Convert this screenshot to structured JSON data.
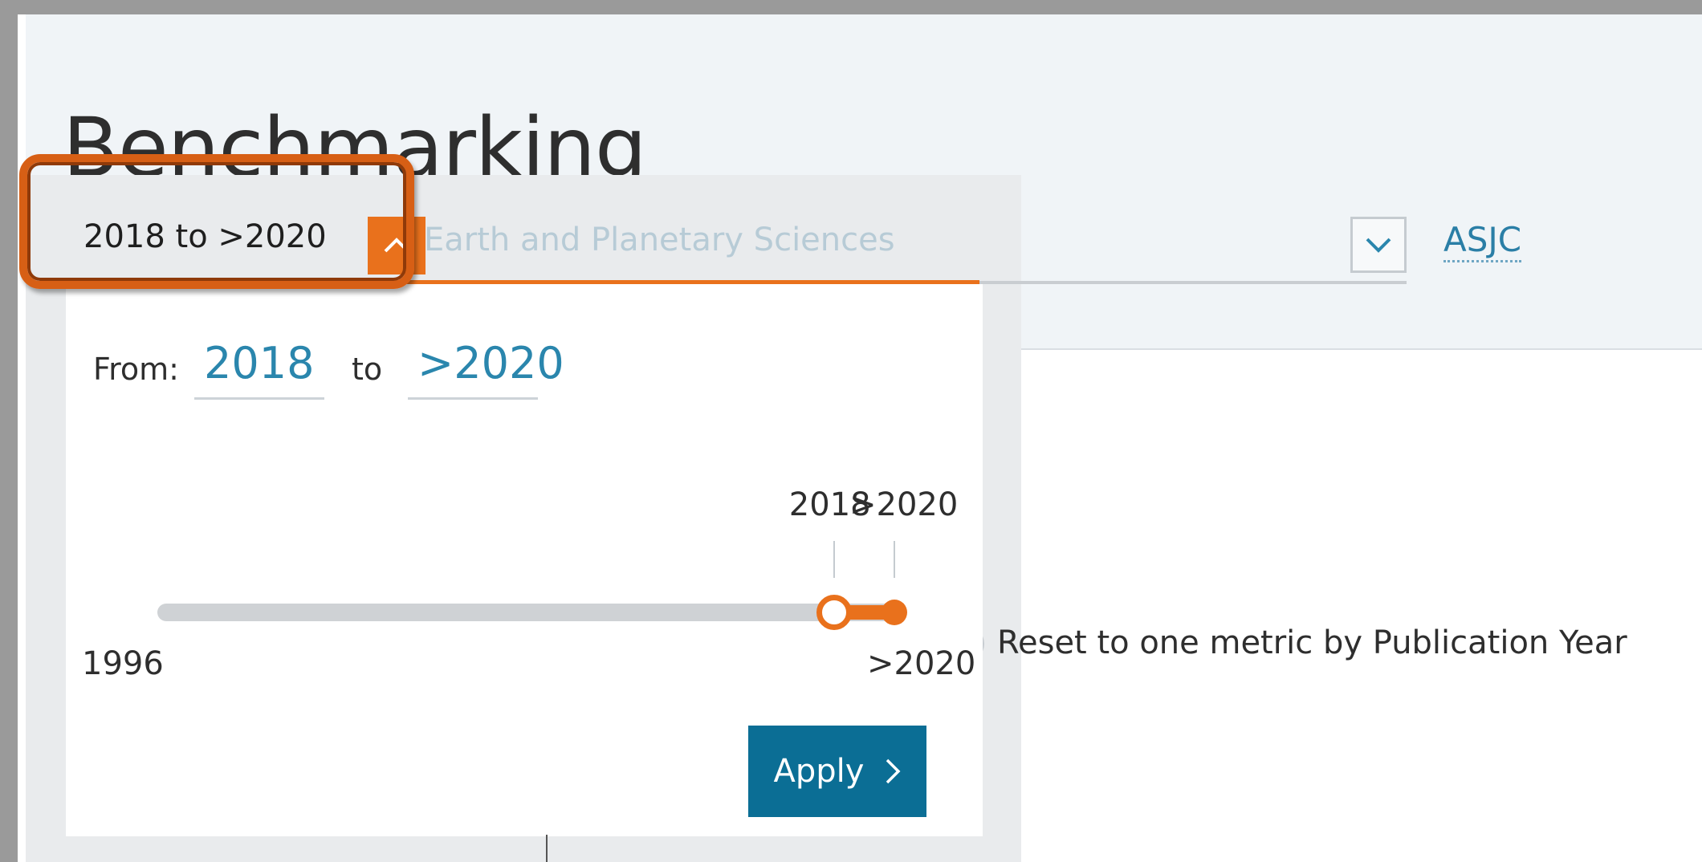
{
  "page": {
    "title": "Benchmarking"
  },
  "year_range": {
    "value": "2018 to >2020",
    "toggle_icon": "chevron-up-icon",
    "expanded": true
  },
  "subject": {
    "value": "Earth and Planetary Sciences",
    "toggle_icon": "chevron-down-icon"
  },
  "asjc_link": "ASJC",
  "popover": {
    "from_label": "From:",
    "from_value": "2018",
    "to_label": "to",
    "to_value": ">2020",
    "slider": {
      "min_label": "1996",
      "max_label": ">2020",
      "from_handle_label": "2018",
      "to_handle_label": ">2020",
      "from_fraction": 0.917,
      "to_fraction": 1.0
    },
    "apply_label": "Apply",
    "apply_icon": "chevron-right-icon"
  },
  "reset_option": {
    "label": "Reset to one metric by Publication Year"
  },
  "colors": {
    "accent": "#e9711c",
    "primary": "#0b6e95",
    "link": "#2a86ad",
    "highlight_border": "#d75f15"
  }
}
